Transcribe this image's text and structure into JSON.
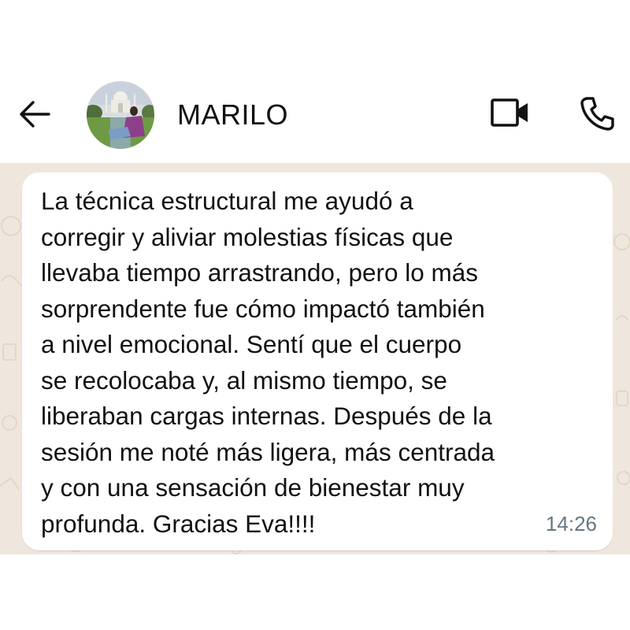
{
  "header": {
    "back_icon": "arrow-left-icon",
    "contact_name": "MARILO",
    "video_icon": "video-camera-icon",
    "call_icon": "phone-icon"
  },
  "message": {
    "text": "La técnica estructural me ayudó a\ncorregir y aliviar molestias físicas que\nllevaba tiempo arrastrando, pero lo más\nsorprendente fue cómo impactó también\na nivel emocional. Sentí que el cuerpo\nse recolocaba y, al mismo tiempo, se\nliberaban cargas internas. Después de la\nsesión me noté más ligera, más centrada\ny con una sensación de bienestar muy\nprofunda. Gracias Eva!!!!",
    "time": "14:26"
  },
  "colors": {
    "chat_background": "#efe7dd",
    "bubble": "#ffffff",
    "timestamp": "#667781"
  }
}
